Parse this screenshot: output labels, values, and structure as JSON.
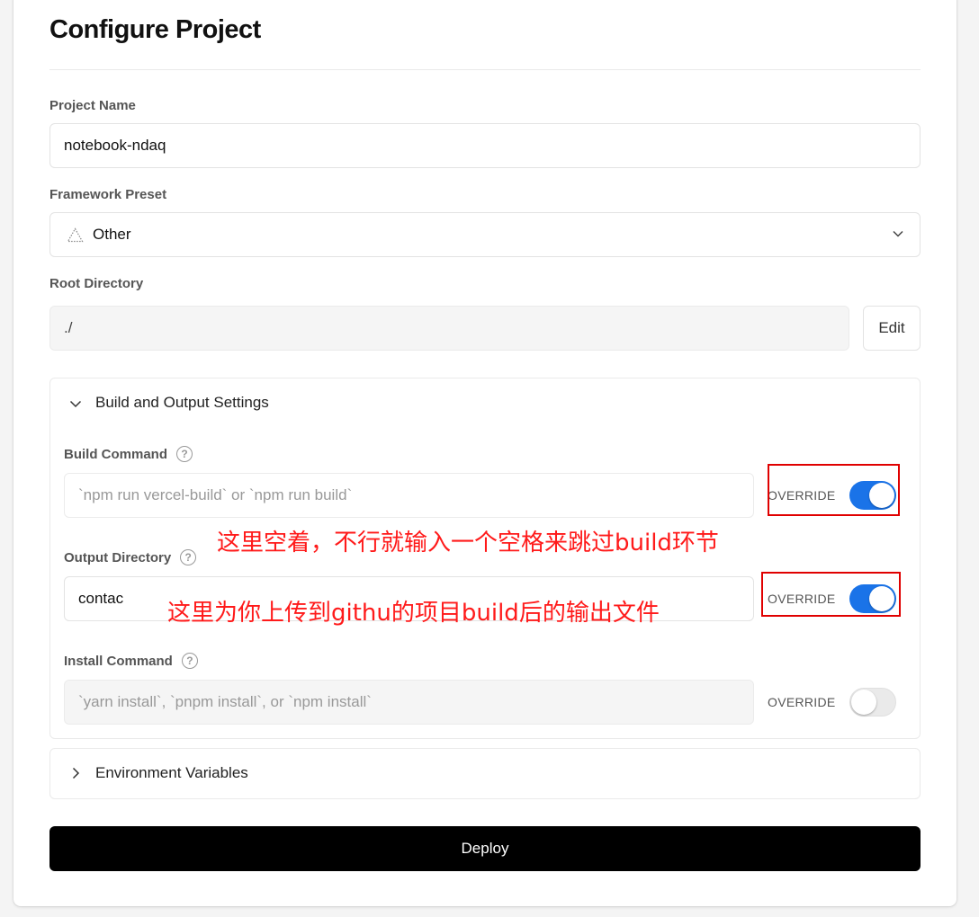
{
  "page_title": "Configure Project",
  "project_name": {
    "label": "Project Name",
    "value": "notebook-ndaq"
  },
  "framework": {
    "label": "Framework Preset",
    "icon": "triangle-icon",
    "value": "Other"
  },
  "root_dir": {
    "label": "Root Directory",
    "value": "./",
    "edit_label": "Edit"
  },
  "build_section": {
    "title": "Build and Output Settings",
    "build_command": {
      "label": "Build Command",
      "placeholder": "`npm run vercel-build` or `npm run build`",
      "override_label": "OVERRIDE",
      "override_on": true
    },
    "output_directory": {
      "label": "Output Directory",
      "value": "contac",
      "override_label": "OVERRIDE",
      "override_on": true
    },
    "install_command": {
      "label": "Install Command",
      "placeholder": "`yarn install`, `pnpm install`, or `npm install`",
      "override_label": "OVERRIDE",
      "override_on": false
    }
  },
  "env_section": {
    "title": "Environment Variables"
  },
  "deploy_label": "Deploy",
  "annotations": {
    "build_note": "这里空着，不行就输入一个空格来跳过build环节",
    "output_note": "这里为你上传到githu的项目build后的输出文件"
  },
  "colors": {
    "toggle_on": "#1a73e8",
    "annotation_red": "#e00000",
    "deploy_bg": "#000000"
  }
}
